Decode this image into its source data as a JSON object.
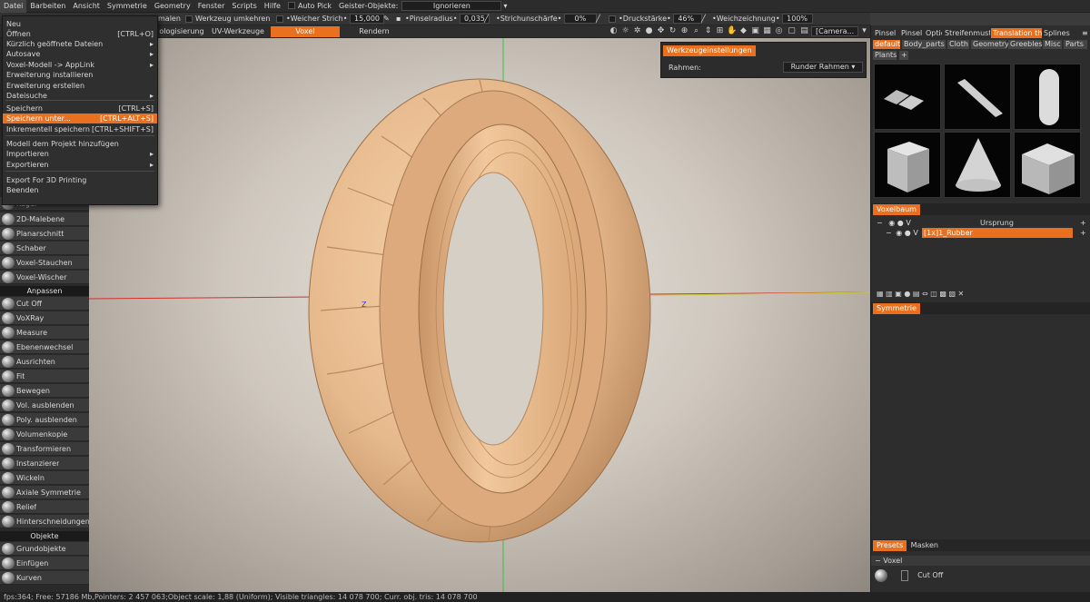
{
  "menubar": [
    "Datei",
    "Barbeiten",
    "Ansicht",
    "Symmetrie",
    "Geometry",
    "Fenster",
    "Scripts",
    "Hilfe"
  ],
  "auto_pick_label": "Auto Pick",
  "ghost_label": "Geister-Objekte:",
  "ghost_value": "Ignorieren",
  "toolbar": {
    "malen": "malen",
    "werkzeug_umkehren": "Werkzeug umkehren",
    "weicher_strich_label": "•Weicher Strich•",
    "weicher_strich_value": "15,000",
    "pinselradius_label": "•Pinselradius•",
    "pinselradius_value": "0,035",
    "strichschaerfe_label": "•Strichunschärfe•",
    "strichschaerfe_value": "0%",
    "druckstaerke_label": "•Druckstärke•",
    "druckstaerke_value": "46%",
    "weichzeichnung_label": "•Weichzeichnung•",
    "weichzeichnung_value": "100%"
  },
  "tabs": {
    "t1": "ologisierung",
    "t2": "UV-Werkzeuge",
    "t3": "Voxel",
    "t4": "Rendern"
  },
  "camera": "[Camera...",
  "file_menu": [
    {
      "label": "Neu",
      "shortcut": ""
    },
    {
      "label": "Öffnen",
      "shortcut": "[CTRL+O]"
    },
    {
      "label": "Kürzlich geöffnete Dateien",
      "shortcut": "▸"
    },
    {
      "label": "Autosave",
      "shortcut": "▸"
    },
    {
      "label": "Voxel-Modell -> AppLink",
      "shortcut": "▸"
    },
    {
      "label": "Erweiterung installieren",
      "shortcut": ""
    },
    {
      "label": "Erweiterung erstellen",
      "shortcut": ""
    },
    {
      "label": "Dateisuche",
      "shortcut": "▸"
    },
    {
      "label": "Speichern",
      "shortcut": "[CTRL+S]"
    },
    {
      "label": "Speichern unter...",
      "shortcut": "[CTRL+ALT+S]"
    },
    {
      "label": "Inkrementell speichern",
      "shortcut": "[CTRL+SHIFT+S]"
    },
    {
      "label": "Modell dem Projekt hinzufügen",
      "shortcut": ""
    },
    {
      "label": "Importieren",
      "shortcut": "▸"
    },
    {
      "label": "Exportieren",
      "shortcut": "▸"
    },
    {
      "label": "Export For 3D Printing",
      "shortcut": ""
    },
    {
      "label": "Beenden",
      "shortcut": ""
    }
  ],
  "left_tools": [
    "Kugel",
    "2D-Malebene",
    "Planarschnitt",
    "Schaber",
    "Voxel-Stauchen",
    "Voxel-Wischer"
  ],
  "section_anpassen": "Anpassen",
  "anpassen_tools": [
    "Cut Off",
    "VoXRay",
    "Measure",
    "Ebenenwechsel",
    "Ausrichten",
    "Fit",
    "Bewegen",
    "Vol. ausblenden",
    "Poly. ausblenden",
    "Volumenkopie",
    "Transformieren",
    "Instanzierer",
    "Wickeln",
    "Axiale Symmetrie",
    "Relief",
    "Hinterschneidungen"
  ],
  "section_objekte": "Objekte",
  "objekte_tools": [
    "Grundobjekte",
    "Einfügen",
    "Kurven"
  ],
  "tool_settings": {
    "title": "Werkzeugeinstellungen",
    "label": "Rahmen:",
    "value": "Runder Rahmen"
  },
  "axis_label": "Z",
  "right": {
    "tabs": [
      "Pinsel",
      "Pinsel",
      "Optio",
      "Streifenmust",
      "Translation there",
      "Splines"
    ],
    "chips": [
      "default",
      "Body_parts",
      "Cloth",
      "Geometry",
      "Greebles",
      "Misc",
      "Parts",
      "Plants"
    ],
    "voxelbaum": "Voxelbaum",
    "ursprung": "Ursprung",
    "rubber": "[1x]1_Rubber",
    "symmetrie": "Symmetrie",
    "presets": "Presets",
    "masken": "Masken",
    "voxel_group": "Voxel",
    "cut_off": "Cut Off"
  },
  "status": "fps:364;   Free: 57186 Mb,Pointers: 2 457 063;Object scale: 1,88 (Uniform); Visible triangles: 14 078 700;  Curr. obj. tris: 14 078 700",
  "colors": {
    "accent": "#e8701e",
    "tire": "#e6b98c"
  }
}
